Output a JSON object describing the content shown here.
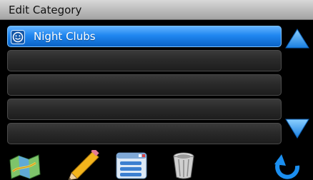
{
  "header": {
    "title": "Edit Category"
  },
  "list": {
    "items": [
      {
        "label": "Night Clubs",
        "icon": "smiley-icon",
        "selected": true
      },
      {
        "label": "",
        "icon": "",
        "selected": false
      },
      {
        "label": "",
        "icon": "",
        "selected": false
      },
      {
        "label": "",
        "icon": "",
        "selected": false
      },
      {
        "label": "",
        "icon": "",
        "selected": false
      }
    ]
  },
  "scroll": {
    "up_icon": "arrow-up-icon",
    "down_icon": "arrow-down-icon"
  },
  "toolbar": {
    "buttons": [
      {
        "name": "map-button",
        "icon": "map-icon"
      },
      {
        "name": "edit-button",
        "icon": "pencil-icon"
      },
      {
        "name": "list-button",
        "icon": "list-icon"
      },
      {
        "name": "delete-button",
        "icon": "trash-icon"
      },
      {
        "name": "back-button",
        "icon": "back-arrow-icon"
      }
    ]
  },
  "colors": {
    "accent": "#1f86f0",
    "row_bg": "#2a2a2a",
    "title_bg": "#bdbdbd"
  }
}
